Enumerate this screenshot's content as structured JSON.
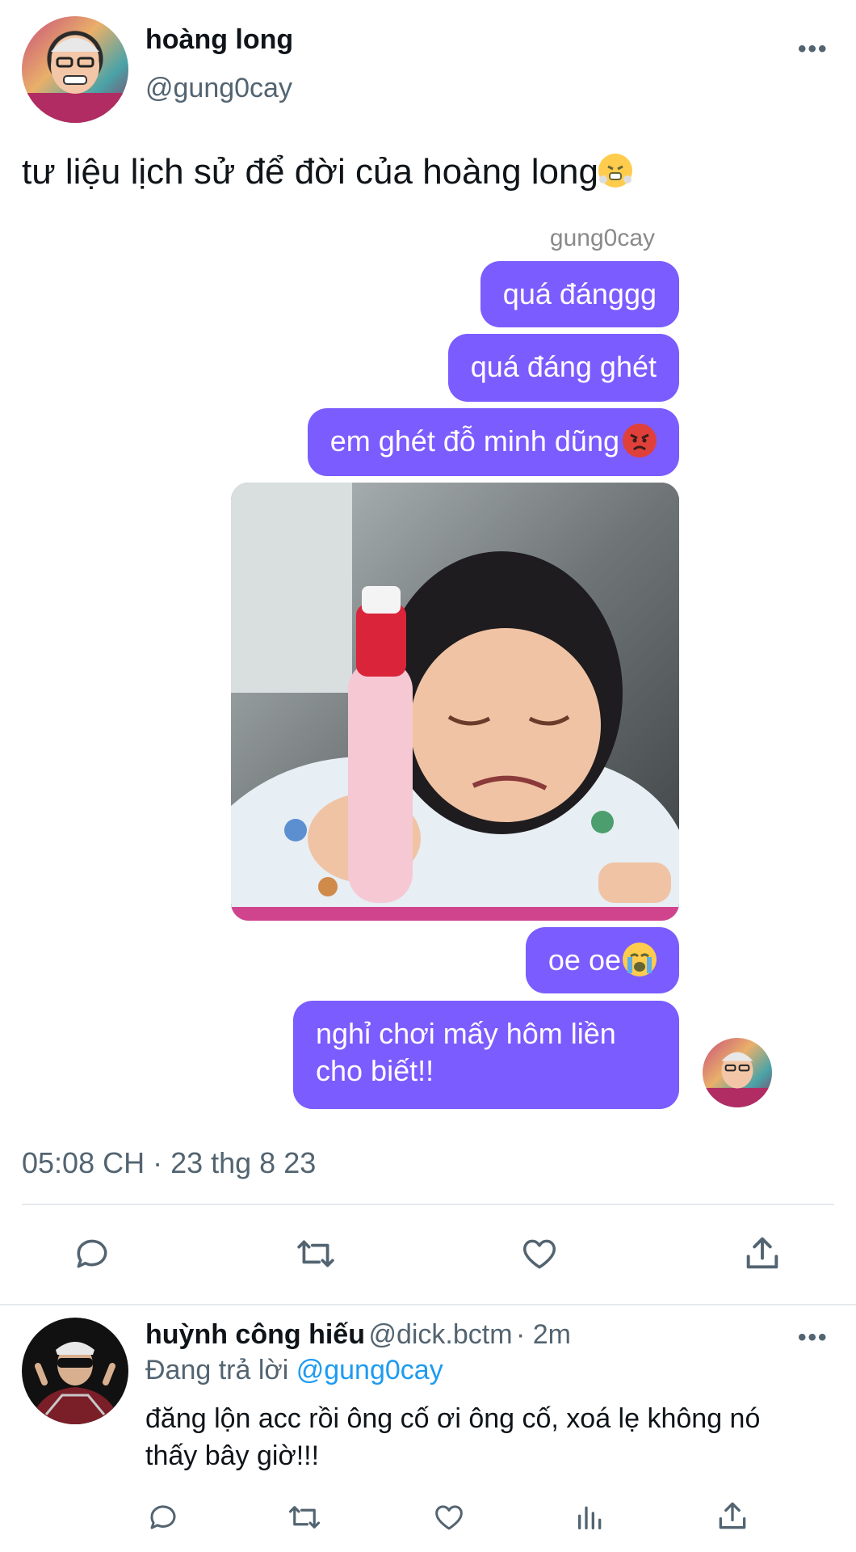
{
  "tweet": {
    "author_name": "hoàng long",
    "author_handle": "@gung0cay",
    "text": "tư liệu lịch sử để đời của hoàng long",
    "text_emoji": "face-with-steam-emoji",
    "timestamp": "05:08 CH · 23 thg 8 23"
  },
  "chat": {
    "username": "gung0cay",
    "messages": [
      {
        "text": "quá đánggg"
      },
      {
        "text": "quá đáng ghét"
      },
      {
        "text": "em ghét đỗ minh dũng",
        "emoji": "angry-face-emoji"
      },
      {
        "text": "oe oe",
        "emoji": "crying-face-emoji"
      },
      {
        "text": "nghỉ chơi mấy hôm liền cho biết!!"
      }
    ],
    "photo": "crying-child-with-bottle-photo"
  },
  "actions": [
    "reply-icon",
    "retweet-icon",
    "like-icon",
    "share-icon"
  ],
  "reply": {
    "author_name": "huỳnh công hiếu",
    "author_handle": "@dick.bctm",
    "time": "· 2m",
    "replying_prefix": "Đang trả lời",
    "replying_to": "@gung0cay",
    "text": "đăng lộn acc rồi ông cố ơi ông cố, xoá lẹ không nó thấy bây giờ!!!",
    "actions": [
      "reply-icon",
      "retweet-icon",
      "like-icon",
      "views-icon",
      "share-icon"
    ]
  },
  "colors": {
    "bubble": "#7b5cff",
    "secondary_text": "#536471",
    "link": "#1d9bf0",
    "divider": "#e6e9ec"
  }
}
